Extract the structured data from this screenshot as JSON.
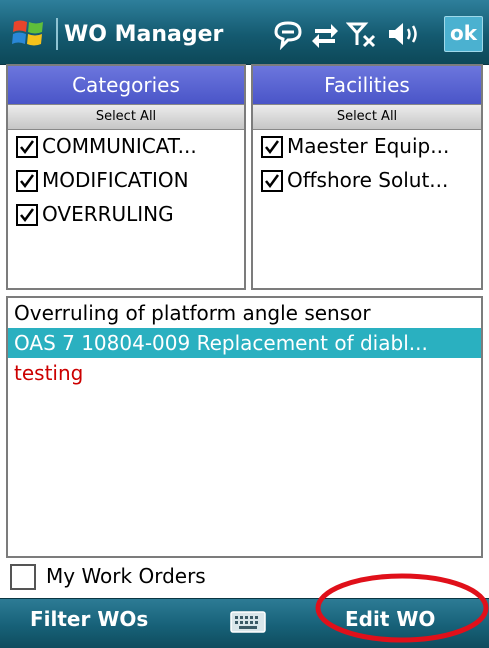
{
  "title_bar": {
    "app_title": "WO Manager",
    "ok_label": "ok",
    "icons": [
      "windows-start-icon",
      "speech-bubble-icon",
      "sync-arrows-icon",
      "no-signal-icon",
      "speaker-icon"
    ]
  },
  "categories": {
    "header": "Categories",
    "select_all": "Select All",
    "items": [
      {
        "label": "COMMUNICAT...",
        "checked": true
      },
      {
        "label": "MODIFICATION",
        "checked": true
      },
      {
        "label": "OVERRULING",
        "checked": true
      }
    ]
  },
  "facilities": {
    "header": "Facilities",
    "select_all": "Select All",
    "items": [
      {
        "label": "Maester Equip...",
        "checked": true
      },
      {
        "label": "Offshore Solut...",
        "checked": true
      }
    ]
  },
  "work_orders": [
    {
      "text": "Overruling of platform angle sensor",
      "state": "normal"
    },
    {
      "text": "OAS 7 10804-009 Replacement of diabl...",
      "state": "selected"
    },
    {
      "text": "testing",
      "state": "highlight-red"
    }
  ],
  "my_work_orders": {
    "label": "My Work Orders",
    "checked": false
  },
  "softkeys": {
    "left": "Filter WOs",
    "right": "Edit WO"
  },
  "colors": {
    "title_bar": "#145a70",
    "panel_header": "#5a63d2",
    "selected_row": "#2ab0c0",
    "red_text": "#cc0000",
    "annotation": "#e0101a"
  }
}
